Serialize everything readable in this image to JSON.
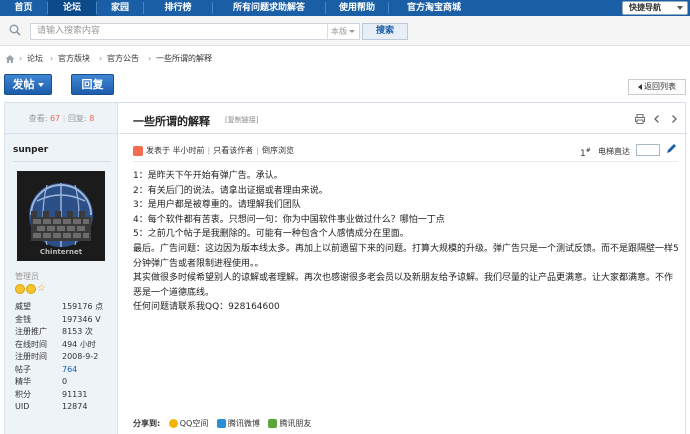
{
  "nav": {
    "items": [
      "首页",
      "论坛",
      "家园",
      "排行榜",
      "所有问题求助解答",
      "使用帮助",
      "官方淘宝商城"
    ],
    "active_index": 1,
    "quick_nav": "快捷导航"
  },
  "search": {
    "placeholder": "请输入搜索内容",
    "scope": "本版",
    "button": "搜索"
  },
  "breadcrumb": [
    "论坛",
    "官方版块",
    "官方公告",
    "一些所谓的解释"
  ],
  "actions": {
    "post": "发帖",
    "reply": "回复",
    "back": "返回列表"
  },
  "stats": {
    "views_label": "查看:",
    "views": "67",
    "replies_label": "回复:",
    "replies": "8"
  },
  "author": {
    "name": "sunper",
    "avatar_caption": "Chinternet",
    "group": "管理员",
    "profile": [
      {
        "k": "威望",
        "v": "159176 点"
      },
      {
        "k": "金钱",
        "v": "197346 V"
      },
      {
        "k": "注册推广",
        "v": "8153 次"
      },
      {
        "k": "在线时间",
        "v": "494 小时"
      },
      {
        "k": "注册时间",
        "v": "2008-9-2"
      },
      {
        "k": "帖子",
        "v": "764"
      },
      {
        "k": "精华",
        "v": "0"
      },
      {
        "k": "积分",
        "v": "91131"
      },
      {
        "k": "UID",
        "v": "12874"
      }
    ]
  },
  "thread": {
    "title": "一些所谓的解释",
    "copy_link": "[复制链接]",
    "posted": "发表于 半小时前",
    "only_author": "只看该作者",
    "reverse": "倒序浏览",
    "floor": "1",
    "floor_suffix": "#",
    "jump_label": "电梯直达",
    "content": [
      "1：是昨天下午开始有弹广告。承认。",
      "2：有关后门的说法。请拿出证据或者理由来说。",
      "3：是用户都是被尊重的。请理解我们团队",
      "4：每个软件都有苦衷。只想问一句：你为中国软件事业做过什么？哪怕一丁点",
      "5：之前几个帖子是我删除的。可能有一种包含个人感情成分在里面。",
      "最后。广告问题：这边因为版本线太多。再加上以前遗留下来的问题。打算大规模的升级。弹广告只是一个测试反馈。而不是跟隔壁一样5分钟弹广告或者限制进程使用。。",
      "其实做很多时候希望别人的谅解或者理解。再次也感谢很多老会员以及新朋友给予谅解。我们尽量的让产品更满意。让大家都满意。不作恶是一个道德底线。",
      "任何问题请联系我QQ：928164600"
    ],
    "share_label": "分享到:",
    "share": [
      "QQ空间",
      "腾讯微博",
      "腾讯朋友"
    ]
  },
  "colors": {
    "nav_bg": "#1a5fa6",
    "accent": "#f26c4f",
    "sidebar_bg": "#eef3f8"
  }
}
